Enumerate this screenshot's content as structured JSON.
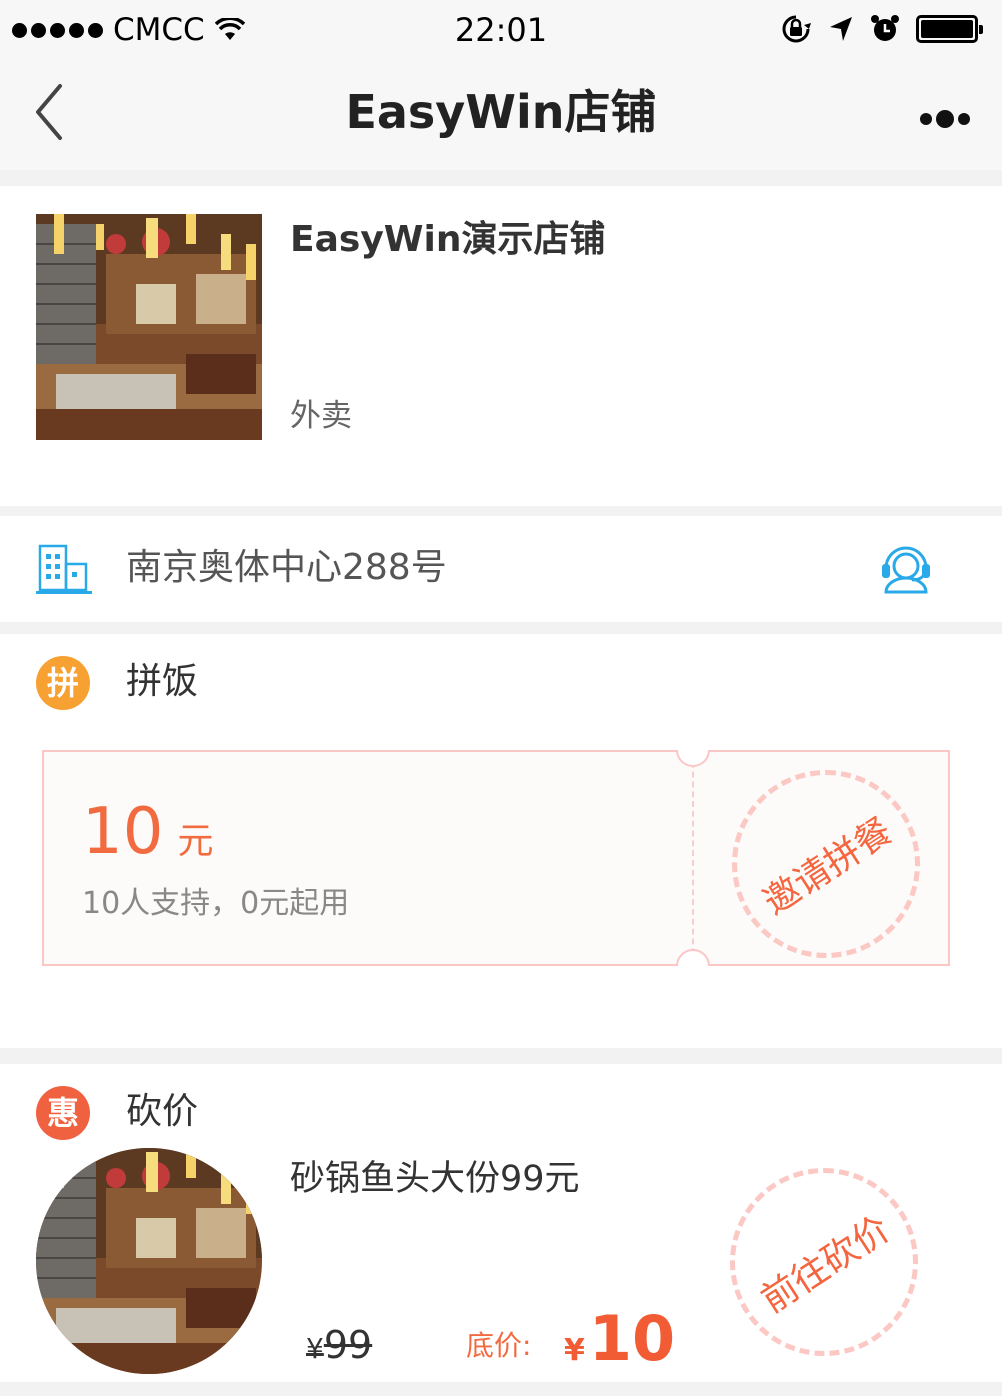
{
  "status_bar": {
    "carrier": "CMCC",
    "time": "22:01"
  },
  "nav": {
    "title": "EasyWin店铺"
  },
  "store": {
    "name": "EasyWin演示店铺",
    "tag": "外卖"
  },
  "address": {
    "text": "南京奥体中心288号"
  },
  "group_meal": {
    "badge": "拼",
    "title": "拼饭",
    "amount": "10",
    "unit": "元",
    "desc": "10人支持，0元起用",
    "action": "邀请拼餐"
  },
  "bargain": {
    "badge": "惠",
    "title": "砍价",
    "product_name": "砂锅鱼头大份99元",
    "currency": "¥",
    "original_price": "99",
    "floor_label": "底价:",
    "floor_price": "10",
    "action": "前往砍价"
  },
  "colors": {
    "accent": "#f26b40",
    "badge_orange": "#f7a133",
    "badge_red": "#f06140",
    "icon_blue": "#29a9e8",
    "stamp_border": "#fbc8c4"
  },
  "icons": [
    "signal-dots-icon",
    "wifi-icon",
    "orientation-lock-icon",
    "location-arrow-icon",
    "alarm-icon",
    "battery-icon",
    "back-chevron-icon",
    "more-dots-icon",
    "building-icon",
    "customer-service-icon"
  ]
}
